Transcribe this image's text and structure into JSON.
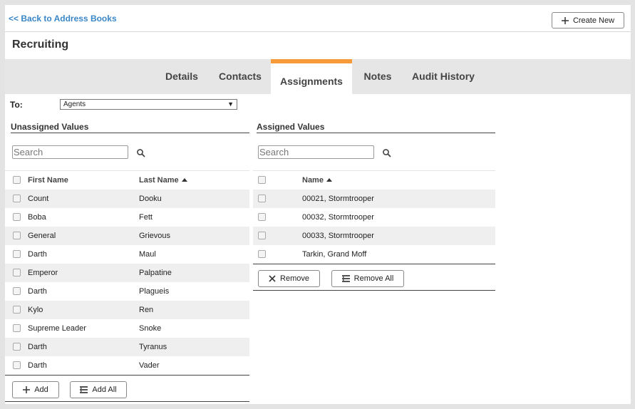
{
  "header": {
    "back_link": "<< Back to Address Books",
    "create_new": "Create New"
  },
  "page_title": "Recruiting",
  "tabs": [
    {
      "label": "Details",
      "active": false
    },
    {
      "label": "Contacts",
      "active": false
    },
    {
      "label": "Assignments",
      "active": true
    },
    {
      "label": "Notes",
      "active": false
    },
    {
      "label": "Audit History",
      "active": false
    }
  ],
  "accent_color": "#f79a3a",
  "to": {
    "label": "To:",
    "selected": "Agents"
  },
  "unassigned": {
    "title": "Unassigned Values",
    "search_placeholder": "Search",
    "columns": {
      "first": "First Name",
      "last": "Last Name"
    },
    "rows": [
      {
        "first": "Count",
        "last": "Dooku"
      },
      {
        "first": "Boba",
        "last": "Fett"
      },
      {
        "first": "General",
        "last": "Grievous"
      },
      {
        "first": "Darth",
        "last": "Maul"
      },
      {
        "first": "Emperor",
        "last": "Palpatine"
      },
      {
        "first": "Darth",
        "last": "Plagueis"
      },
      {
        "first": "Kylo",
        "last": "Ren"
      },
      {
        "first": "Supreme Leader",
        "last": "Snoke"
      },
      {
        "first": "Darth",
        "last": "Tyranus"
      },
      {
        "first": "Darth",
        "last": "Vader"
      }
    ],
    "add_label": "Add",
    "add_all_label": "Add All"
  },
  "assigned": {
    "title": "Assigned Values",
    "search_placeholder": "Search",
    "columns": {
      "name": "Name"
    },
    "rows": [
      {
        "name": "00021, Stormtrooper"
      },
      {
        "name": "00032, Stormtrooper"
      },
      {
        "name": "00033, Stormtrooper"
      },
      {
        "name": "Tarkin, Grand Moff"
      }
    ],
    "remove_label": "Remove",
    "remove_all_label": "Remove All"
  }
}
